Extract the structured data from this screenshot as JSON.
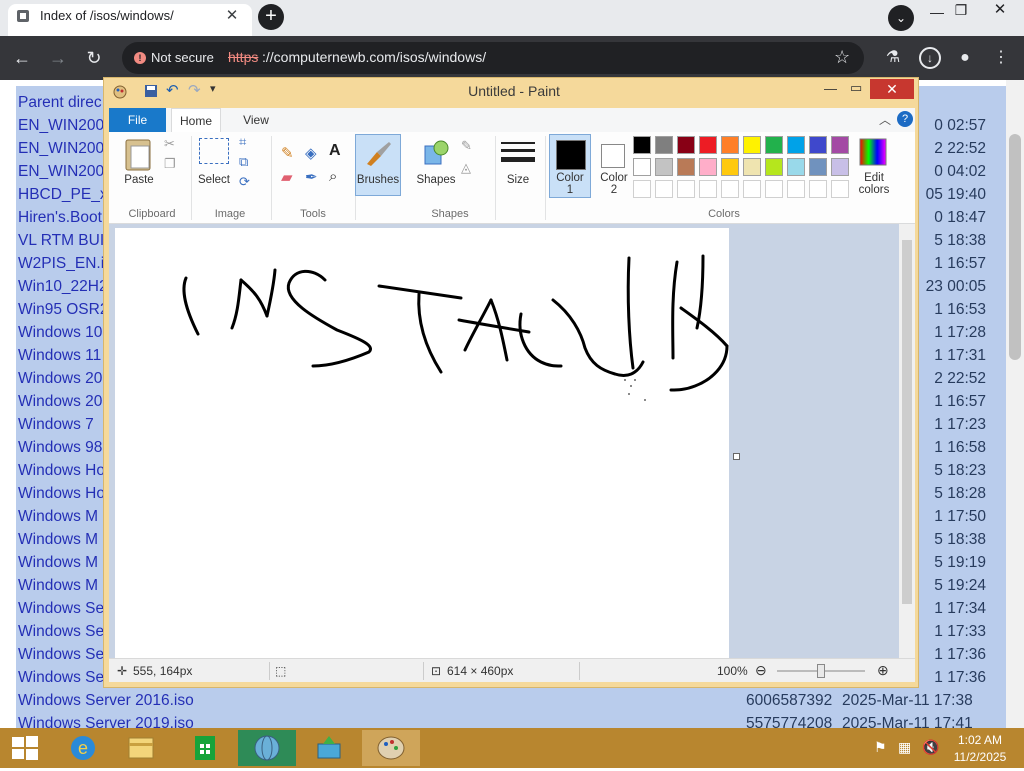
{
  "browser": {
    "tab_title": "Index of /isos/windows/",
    "tab_close": "✕",
    "new_tab": "+",
    "url_scheme": "https",
    "url_rest": "://computernewb.com/isos/windows/",
    "not_secure_label": "Not secure"
  },
  "listing": {
    "rows": [
      {
        "name": "Parent direc",
        "size": "",
        "date": ""
      },
      {
        "name": "EN_WIN200",
        "size": "",
        "date": "0 02:57"
      },
      {
        "name": "EN_WIN200",
        "size": "",
        "date": "2 22:52"
      },
      {
        "name": "EN_WIN200",
        "size": "",
        "date": "0 04:02"
      },
      {
        "name": "HBCD_PE_x6",
        "size": "",
        "date": "05 19:40"
      },
      {
        "name": "Hiren's.Boot",
        "size": "",
        "date": "0 18:47"
      },
      {
        "name": "VL RTM BUI",
        "size": "",
        "date": "5 18:38"
      },
      {
        "name": "W2PIS_EN.is",
        "size": "",
        "date": "1 16:57"
      },
      {
        "name": "Win10_22H2",
        "size": "",
        "date": "23 00:05"
      },
      {
        "name": "Win95 OSR2",
        "size": "",
        "date": "1 16:53"
      },
      {
        "name": "Windows 10",
        "size": "",
        "date": "1 17:28"
      },
      {
        "name": "Windows 11",
        "size": "",
        "date": "1 17:31"
      },
      {
        "name": "Windows 20",
        "size": "",
        "date": "2 22:52"
      },
      {
        "name": "Windows 20",
        "size": "",
        "date": "1 16:57"
      },
      {
        "name": "Windows 7",
        "size": "",
        "date": "1 17:23"
      },
      {
        "name": "Windows 98",
        "size": "",
        "date": "1 16:58"
      },
      {
        "name": "Windows Ho",
        "size": "",
        "date": "5 18:23"
      },
      {
        "name": "Windows Ho",
        "size": "",
        "date": "5 18:28"
      },
      {
        "name": "Windows M",
        "size": "",
        "date": "1 17:50"
      },
      {
        "name": "Windows M",
        "size": "",
        "date": "5 18:38"
      },
      {
        "name": "Windows M",
        "size": "",
        "date": "5 19:19"
      },
      {
        "name": "Windows M",
        "size": "",
        "date": "5 19:24"
      },
      {
        "name": "Windows Se",
        "size": "",
        "date": "1 17:34"
      },
      {
        "name": "Windows Se",
        "size": "",
        "date": "1 17:33"
      },
      {
        "name": "Windows Se",
        "size": "",
        "date": "1 17:36"
      },
      {
        "name": "Windows Se",
        "size": "",
        "date": "1 17:36"
      },
      {
        "name": "Windows Server 2016.iso",
        "size": "6006587392",
        "date": "2025-Mar-11 17:38"
      },
      {
        "name": "Windows Server 2019.iso",
        "size": "5575774208",
        "date": "2025-Mar-11 17:41"
      }
    ]
  },
  "paint": {
    "title": "Untitled - Paint",
    "tabs": [
      "File",
      "Home",
      "View"
    ],
    "groups": [
      "Clipboard",
      "Image",
      "Tools",
      "Shapes",
      "Colors"
    ],
    "labels": {
      "paste": "Paste",
      "select": "Select",
      "brushes": "Brushes",
      "shapes": "Shapes",
      "size": "Size",
      "color1": "Color\n1",
      "color2": "Color\n2",
      "edit_colors": "Edit\ncolors"
    },
    "palette_row1": [
      "#000000",
      "#7f7f7f",
      "#880015",
      "#ed1c24",
      "#ff7f27",
      "#fff200",
      "#22b14c",
      "#00a2e8",
      "#3f48cc",
      "#a349a4"
    ],
    "palette_row2": [
      "#ffffff",
      "#c3c3c3",
      "#b97a57",
      "#ffaec9",
      "#ffc90e",
      "#efe4b0",
      "#b5e61d",
      "#99d9ea",
      "#7092be",
      "#c8bfe7"
    ],
    "status": {
      "cursor_pos": "555, 164px",
      "canvas_size": "614 × 460px",
      "zoom": "100%"
    }
  },
  "taskbar": {
    "time": "1:02 AM",
    "date": "11/2/2025"
  }
}
